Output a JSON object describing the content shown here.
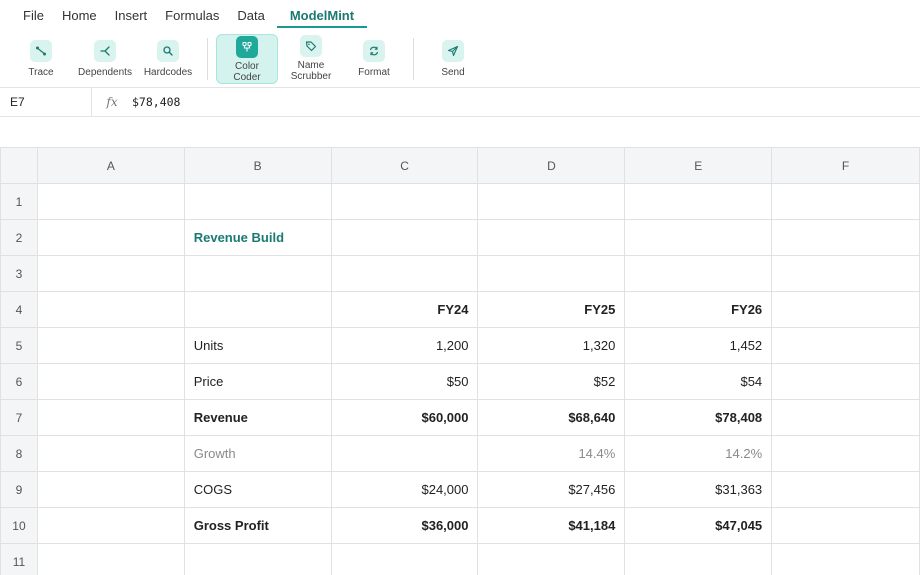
{
  "menu": {
    "items": [
      {
        "label": "File"
      },
      {
        "label": "Home"
      },
      {
        "label": "Insert"
      },
      {
        "label": "Formulas"
      },
      {
        "label": "Data"
      },
      {
        "label": "ModelMint",
        "active": true
      }
    ]
  },
  "ribbon": {
    "buttons": [
      {
        "label": "Trace",
        "icon": "trace-icon"
      },
      {
        "label": "Dependents",
        "icon": "dependents-icon"
      },
      {
        "label": "Hardcodes",
        "icon": "search-icon"
      },
      {
        "label": "Color\nCoder",
        "icon": "color-coder-icon",
        "active": true
      },
      {
        "label": "Name\nScrubber",
        "icon": "tag-icon"
      },
      {
        "label": "Format",
        "icon": "refresh-icon"
      },
      {
        "label": "Send",
        "icon": "send-icon"
      }
    ]
  },
  "formula_bar": {
    "cell_ref": "E7",
    "fx": "fx",
    "value": "$78,408"
  },
  "sheet": {
    "columns": [
      "A",
      "B",
      "C",
      "D",
      "E",
      "F"
    ],
    "rows": [
      {
        "n": "1",
        "cells": [
          "",
          "",
          "",
          "",
          "",
          ""
        ]
      },
      {
        "n": "2",
        "cells": [
          "",
          "Revenue Build",
          "",
          "",
          "",
          ""
        ]
      },
      {
        "n": "3",
        "cells": [
          "",
          "",
          "",
          "",
          "",
          ""
        ]
      },
      {
        "n": "4",
        "cells": [
          "",
          "",
          "FY24",
          "FY25",
          "FY26",
          ""
        ]
      },
      {
        "n": "5",
        "cells": [
          "",
          "Units",
          "1,200",
          "1,320",
          "1,452",
          ""
        ]
      },
      {
        "n": "6",
        "cells": [
          "",
          "Price",
          "$50",
          "$52",
          "$54",
          ""
        ]
      },
      {
        "n": "7",
        "cells": [
          "",
          "Revenue",
          "$60,000",
          "$68,640",
          "$78,408",
          ""
        ]
      },
      {
        "n": "8",
        "cells": [
          "",
          "Growth",
          "",
          "14.4%",
          "14.2%",
          ""
        ]
      },
      {
        "n": "9",
        "cells": [
          "",
          "COGS",
          "$24,000",
          "$27,456",
          "$31,363",
          ""
        ]
      },
      {
        "n": "10",
        "cells": [
          "",
          "Gross Profit",
          "$36,000",
          "$41,184",
          "$47,045",
          ""
        ]
      },
      {
        "n": "11",
        "cells": [
          "",
          "",
          "",
          "",
          "",
          ""
        ]
      }
    ]
  },
  "colors": {
    "accent": "#1a7a72",
    "accent_light": "#d9f3ef",
    "header_bg": "#f4f5f6",
    "gridline": "#e1e1e1"
  }
}
